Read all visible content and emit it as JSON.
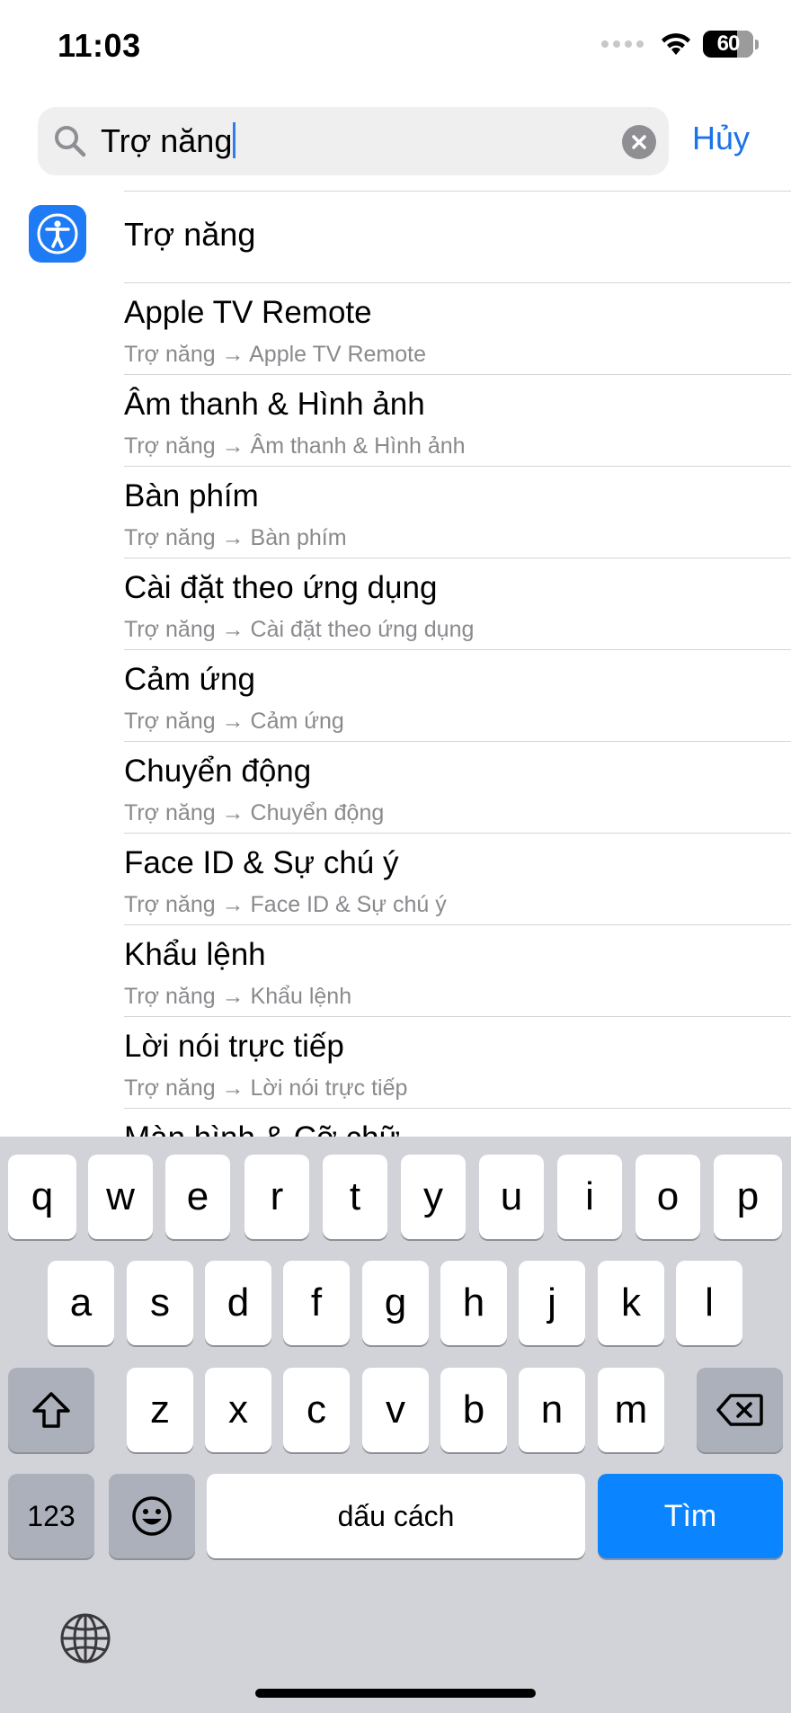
{
  "status_bar": {
    "time": "11:03",
    "battery": "60"
  },
  "search": {
    "value": "Trợ năng",
    "cancel_label": "Hủy"
  },
  "main_result": {
    "title": "Trợ năng",
    "icon": "accessibility-icon"
  },
  "results": [
    {
      "title": "Apple TV Remote",
      "path": "Trợ năng → Apple TV Remote"
    },
    {
      "title": "Âm thanh & Hình ảnh",
      "path": "Trợ năng → Âm thanh & Hình ảnh"
    },
    {
      "title": "Bàn phím",
      "path": "Trợ năng → Bàn phím"
    },
    {
      "title": "Cài đặt theo ứng dụng",
      "path": "Trợ năng → Cài đặt theo ứng dụng"
    },
    {
      "title": "Cảm ứng",
      "path": "Trợ năng → Cảm ứng"
    },
    {
      "title": "Chuyển động",
      "path": "Trợ năng → Chuyển động"
    },
    {
      "title": "Face ID & Sự chú ý",
      "path": "Trợ năng → Face ID & Sự chú ý"
    },
    {
      "title": "Khẩu lệnh",
      "path": "Trợ năng → Khẩu lệnh"
    },
    {
      "title": "Lời nói trực tiếp",
      "path": "Trợ năng → Lời nói trực tiếp"
    },
    {
      "title": "Màn hình & Cỡ chữ",
      "path": ""
    }
  ],
  "keyboard": {
    "row1": [
      "q",
      "w",
      "e",
      "r",
      "t",
      "y",
      "u",
      "i",
      "o",
      "p"
    ],
    "row2": [
      "a",
      "s",
      "d",
      "f",
      "g",
      "h",
      "j",
      "k",
      "l"
    ],
    "row3": [
      "z",
      "x",
      "c",
      "v",
      "b",
      "n",
      "m"
    ],
    "numbers_label": "123",
    "space_label": "dấu cách",
    "search_label": "Tìm"
  },
  "colors": {
    "accent": "#1a73e8",
    "search_key": "#0a84ff",
    "app_icon": "#1e7bf5"
  }
}
